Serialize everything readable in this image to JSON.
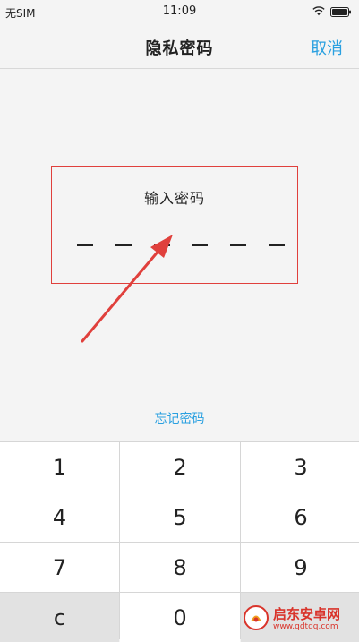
{
  "status_bar": {
    "carrier": "无SIM",
    "time": "11:09"
  },
  "nav": {
    "title": "隐私密码",
    "cancel_label": "取消"
  },
  "pin_entry": {
    "title": "输入密码",
    "digits_entered": 0,
    "digits_total": 6
  },
  "forgot_label": "忘记密码",
  "keypad": {
    "keys": [
      "1",
      "2",
      "3",
      "4",
      "5",
      "6",
      "7",
      "8",
      "9",
      "c",
      "0",
      ""
    ]
  },
  "watermark": {
    "name": "启东安卓网",
    "url": "www.qdtdq.com"
  },
  "colors": {
    "accent": "#2aa0e0",
    "highlight": "#e0403c",
    "watermark": "#d9342b"
  },
  "icons": [
    "wifi-icon",
    "battery-icon",
    "arrow-annotation",
    "watermark-logo"
  ]
}
